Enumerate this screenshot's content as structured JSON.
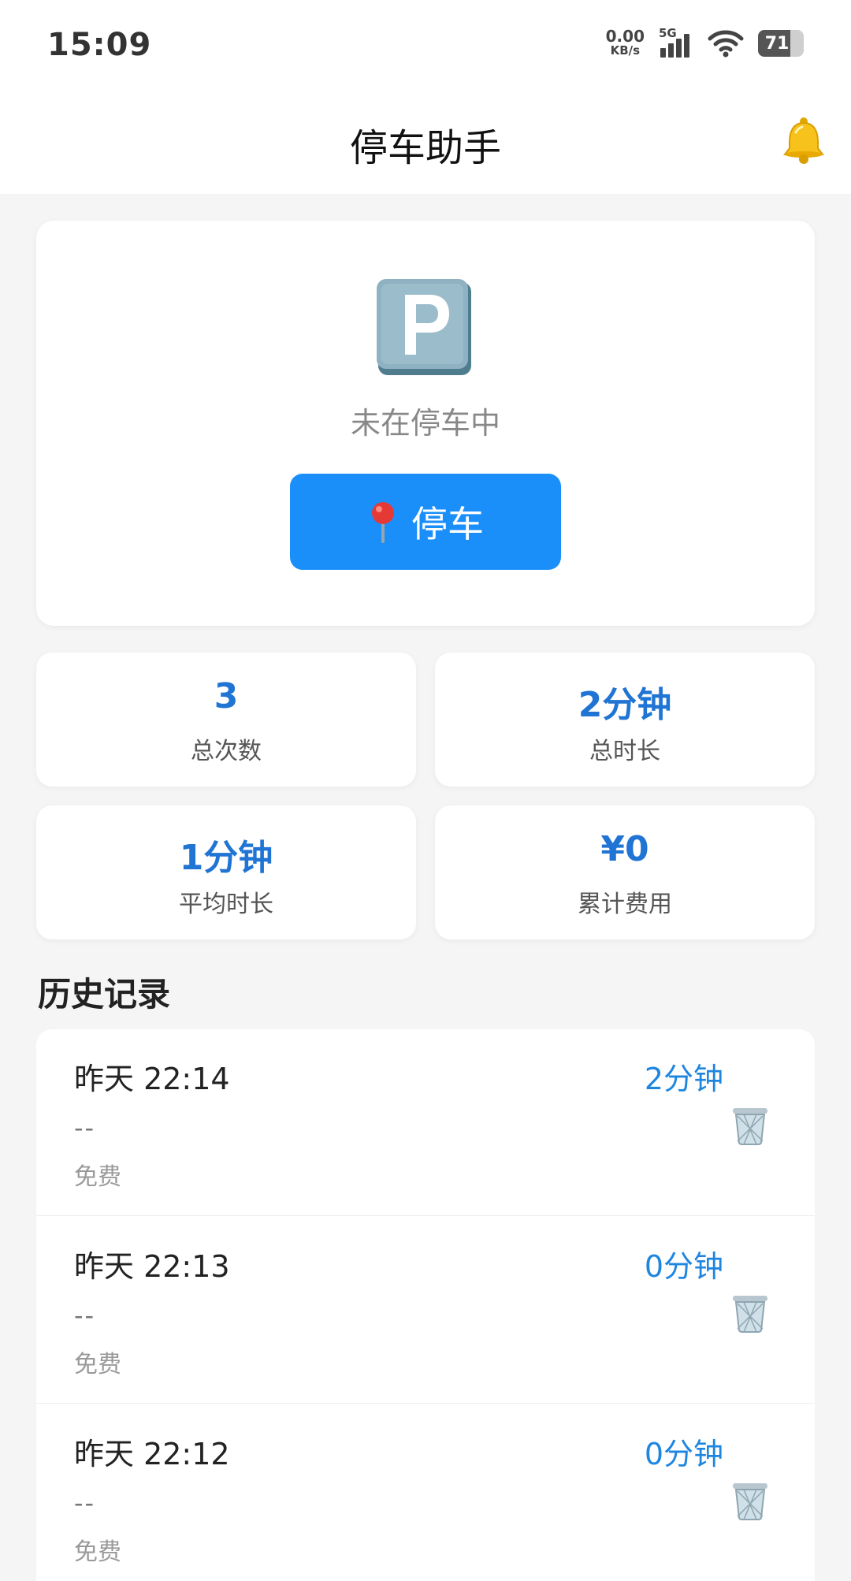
{
  "status_bar": {
    "time": "15:09",
    "net_speed": "0.00",
    "net_unit": "KB/s",
    "network": "5G",
    "battery": "71",
    "battery_fraction": 0.71
  },
  "header": {
    "title": "停车助手",
    "bell_icon": "bell-icon"
  },
  "park_card": {
    "sign_icon": "parking-sign-icon",
    "status_text": "未在停车中",
    "button_icon": "map-pin-icon",
    "button_label": "停车"
  },
  "stats": [
    {
      "value": "3",
      "label": "总次数"
    },
    {
      "value": "2分钟",
      "label": "总时长"
    },
    {
      "value": "1分钟",
      "label": "平均时长"
    },
    {
      "value": "¥0",
      "label": "累计费用"
    }
  ],
  "history": {
    "title": "历史记录",
    "items": [
      {
        "time": "昨天 22:14",
        "location": "--",
        "fee": "免费",
        "duration": "2分钟"
      },
      {
        "time": "昨天 22:13",
        "location": "--",
        "fee": "免费",
        "duration": "0分钟"
      },
      {
        "time": "昨天 22:12",
        "location": "--",
        "fee": "免费",
        "duration": "0分钟"
      }
    ]
  },
  "colors": {
    "primary": "#1a8ffa",
    "stat_value": "#1f74d4",
    "duration": "#1f86e0",
    "background": "#f5f5f5"
  }
}
